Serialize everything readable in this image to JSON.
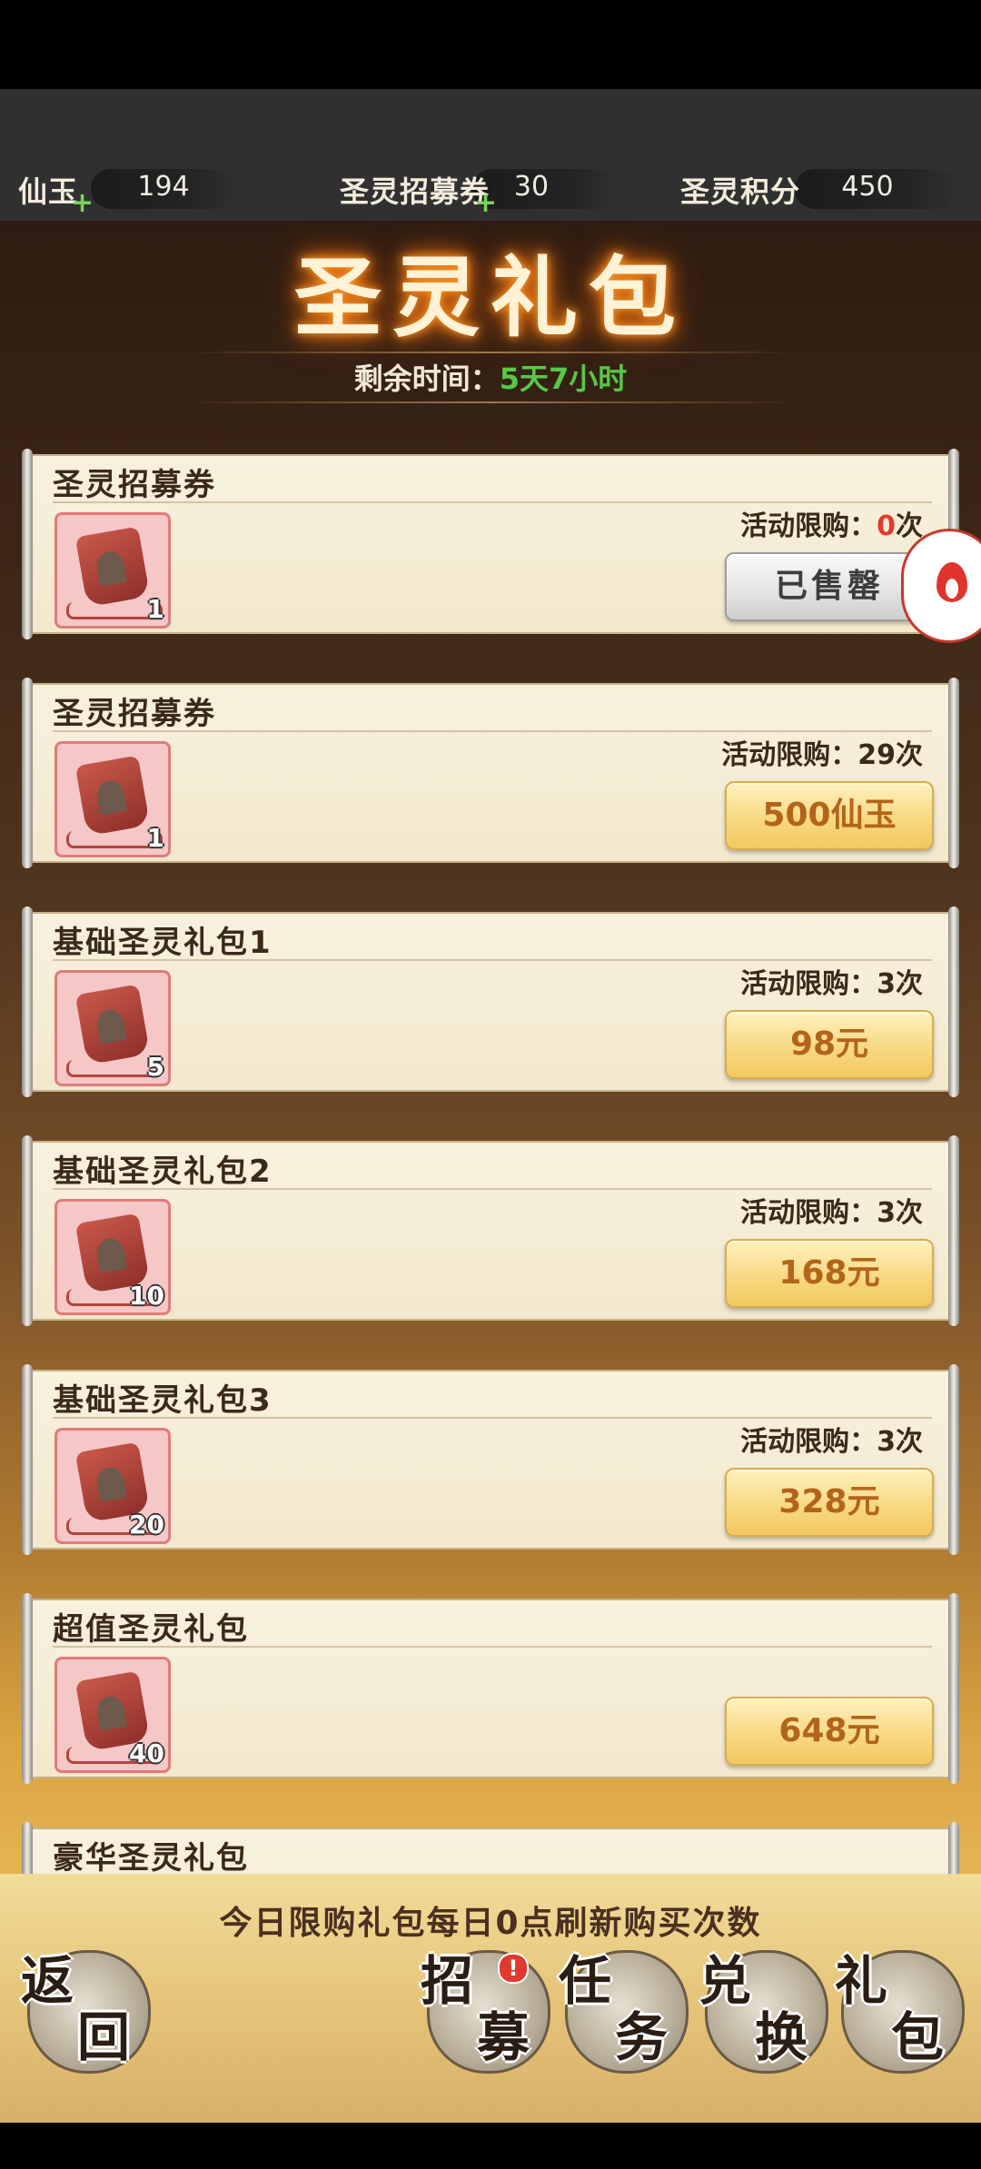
{
  "currencies": [
    {
      "label": "仙玉",
      "value": "194",
      "plus": "+"
    },
    {
      "label": "圣灵招募券",
      "value": "30",
      "plus": "+"
    },
    {
      "label": "圣灵积分",
      "value": "450",
      "plus": ""
    }
  ],
  "header": {
    "title": "圣灵礼包",
    "timer_label": "剩余时间：",
    "timer_value": "5天7小时"
  },
  "packs": [
    {
      "name": "圣灵招募券",
      "count": "1",
      "limit_prefix": "活动限购：",
      "limit_value": "0",
      "limit_suffix": "次",
      "button": "已售罄",
      "sold_out": true
    },
    {
      "name": "圣灵招募券",
      "count": "1",
      "limit_prefix": "活动限购：",
      "limit_value": "29",
      "limit_suffix": "次",
      "button": "500仙玉",
      "sold_out": false
    },
    {
      "name": "基础圣灵礼包1",
      "count": "5",
      "limit_prefix": "活动限购：",
      "limit_value": "3",
      "limit_suffix": "次",
      "button": "98元",
      "sold_out": false
    },
    {
      "name": "基础圣灵礼包2",
      "count": "10",
      "limit_prefix": "活动限购：",
      "limit_value": "3",
      "limit_suffix": "次",
      "button": "168元",
      "sold_out": false
    },
    {
      "name": "基础圣灵礼包3",
      "count": "20",
      "limit_prefix": "活动限购：",
      "limit_value": "3",
      "limit_suffix": "次",
      "button": "328元",
      "sold_out": false
    },
    {
      "name": "超值圣灵礼包",
      "count": "40",
      "limit_prefix": "",
      "limit_value": "",
      "limit_suffix": "",
      "button": "648元",
      "sold_out": false
    },
    {
      "name": "豪华圣灵礼包"
    }
  ],
  "footer": {
    "notice": "今日限购礼包每日0点刷新购买次数",
    "badge": "!",
    "nav": [
      {
        "c1": "返",
        "c2": "回"
      },
      {
        "c1": "招",
        "c2": "募"
      },
      {
        "c1": "任",
        "c2": "务"
      },
      {
        "c1": "兑",
        "c2": "换"
      },
      {
        "c1": "礼",
        "c2": "包"
      }
    ]
  },
  "colors": {
    "accent_gold": "#f7d77e",
    "timer_green": "#58c846",
    "limit_red": "#e23a2c"
  }
}
